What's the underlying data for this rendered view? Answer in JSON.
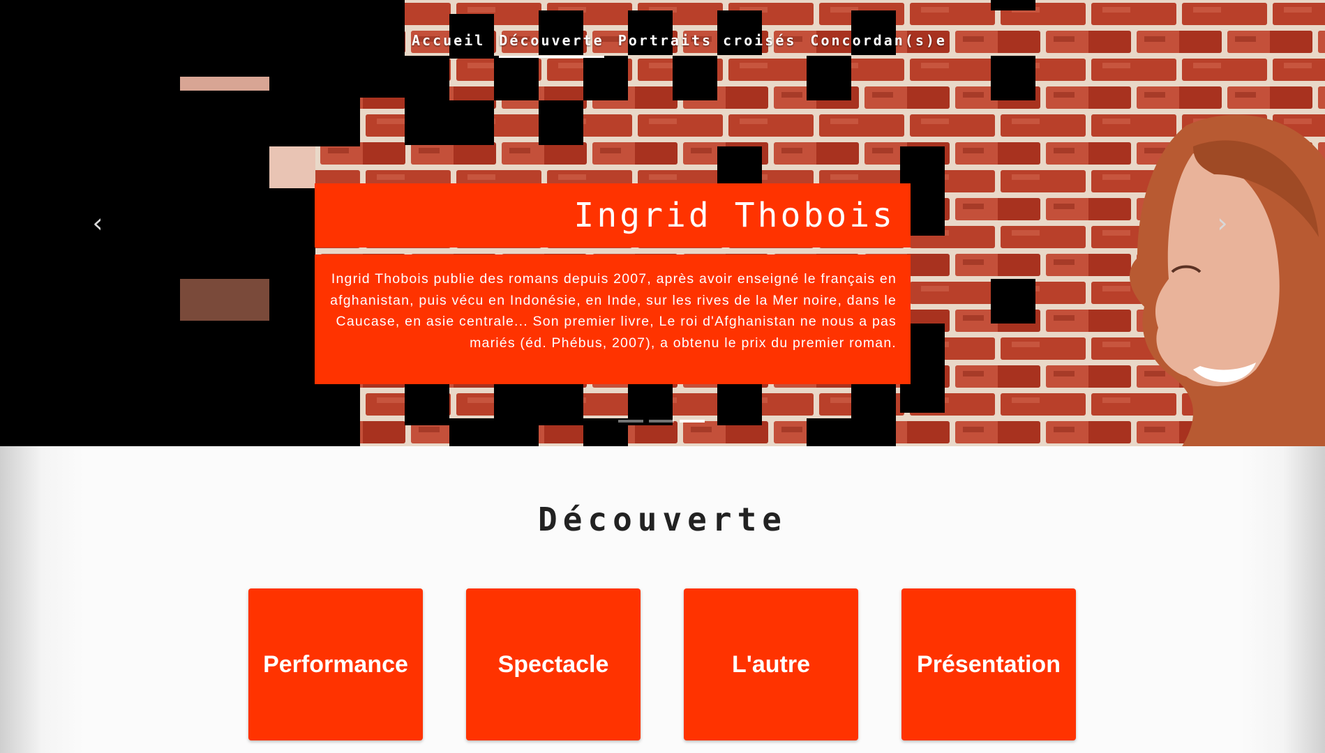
{
  "nav": {
    "items": [
      {
        "label": "Accueil"
      },
      {
        "label": "Découverte"
      },
      {
        "label": "Portraits croisés"
      },
      {
        "label": "Concordan(s)e"
      }
    ],
    "active_index": 1
  },
  "carousel": {
    "title": "Ingrid Thobois",
    "description": "Ingrid Thobois publie des romans depuis 2007, après avoir enseigné le français en afghanistan, puis vécu en Indonésie, en Inde, sur les rives de la Mer noire, dans le Caucase, en asie centrale... Son premier livre, Le roi d'Afghanistan ne nous a pas mariés (éd. Phébus, 2007), a obtenu le prix du premier roman.",
    "prev_glyph": "‹",
    "next_glyph": "›",
    "slide_count": 3,
    "active_slide": 3
  },
  "section": {
    "title": "Découverte",
    "cards": [
      {
        "label": "Performance"
      },
      {
        "label": "Spectacle"
      },
      {
        "label": "L'autre"
      },
      {
        "label": "Présentation"
      }
    ]
  },
  "colors": {
    "accent": "#ff3300",
    "hero_dark": "#000000",
    "brick": "#b23a26"
  }
}
